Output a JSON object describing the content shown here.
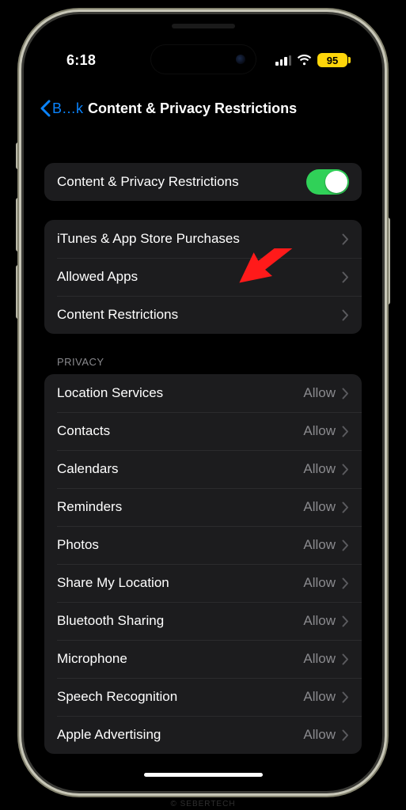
{
  "status": {
    "time": "6:18",
    "battery_text": "95"
  },
  "nav": {
    "back_label": "B…k",
    "title": "Content & Privacy Restrictions"
  },
  "group_toggle": {
    "label": "Content & Privacy Restrictions",
    "on": true
  },
  "group_main": {
    "items": [
      {
        "label": "iTunes & App Store Purchases"
      },
      {
        "label": "Allowed Apps"
      },
      {
        "label": "Content Restrictions"
      }
    ]
  },
  "sections": {
    "privacy_header": "Privacy"
  },
  "group_privacy": {
    "items": [
      {
        "label": "Location Services",
        "value": "Allow"
      },
      {
        "label": "Contacts",
        "value": "Allow"
      },
      {
        "label": "Calendars",
        "value": "Allow"
      },
      {
        "label": "Reminders",
        "value": "Allow"
      },
      {
        "label": "Photos",
        "value": "Allow"
      },
      {
        "label": "Share My Location",
        "value": "Allow"
      },
      {
        "label": "Bluetooth Sharing",
        "value": "Allow"
      },
      {
        "label": "Microphone",
        "value": "Allow"
      },
      {
        "label": "Speech Recognition",
        "value": "Allow"
      },
      {
        "label": "Apple Advertising",
        "value": "Allow"
      }
    ]
  },
  "watermark": "© SEBERTECH"
}
